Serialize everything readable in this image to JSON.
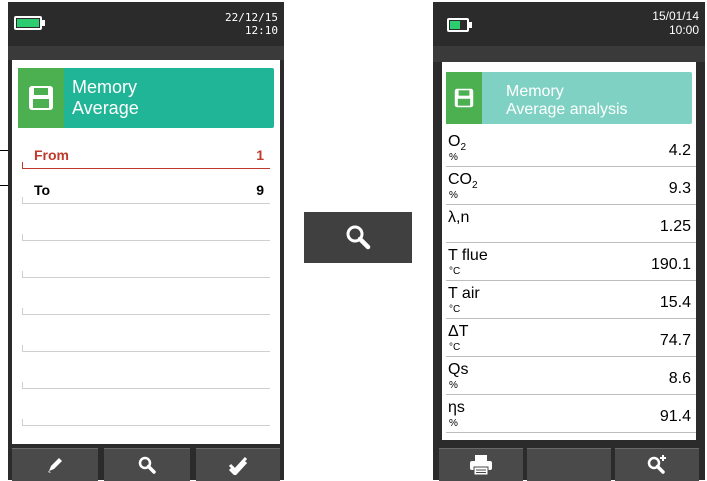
{
  "left_screen": {
    "datetime": {
      "date": "22/12/15",
      "time": "12:10"
    },
    "header": {
      "line1": "Memory",
      "line2": "Average"
    },
    "rows": [
      {
        "label": "From",
        "value": "1"
      },
      {
        "label": "To",
        "value": "9"
      }
    ],
    "toolbar": [
      "pencil-icon",
      "search-icon",
      "double-check-icon"
    ]
  },
  "center_key": {
    "icon": "search-icon"
  },
  "right_screen": {
    "datetime": {
      "date": "15/01/14",
      "time": "10:00"
    },
    "header": {
      "line1": "Memory",
      "line2": "Average analysis"
    },
    "measurements": [
      {
        "label": "O",
        "sub": "2",
        "unit": "%",
        "value": "4.2"
      },
      {
        "label": "CO",
        "sub": "2",
        "unit": "%",
        "value": "9.3"
      },
      {
        "label": "λ,n",
        "sub": "",
        "unit": "",
        "value": "1.25"
      },
      {
        "label": "T flue",
        "sub": "",
        "unit": "°C",
        "value": "190.1"
      },
      {
        "label": "T air",
        "sub": "",
        "unit": "°C",
        "value": "15.4"
      },
      {
        "label": "ΔT",
        "sub": "",
        "unit": "°C",
        "value": "74.7"
      },
      {
        "label": "Qs",
        "sub": "",
        "unit": "%",
        "value": "8.6"
      },
      {
        "label": "ηs",
        "sub": "",
        "unit": "%",
        "value": "91.4"
      }
    ],
    "toolbar": [
      "printer-icon",
      "",
      "zoom-plus-icon"
    ]
  },
  "colors": {
    "teal": "#20b596",
    "teal_light": "#7fd2c3",
    "green_icon": "#4caf50",
    "red_text": "#c0392b",
    "battery_green": "#2ecc71"
  }
}
